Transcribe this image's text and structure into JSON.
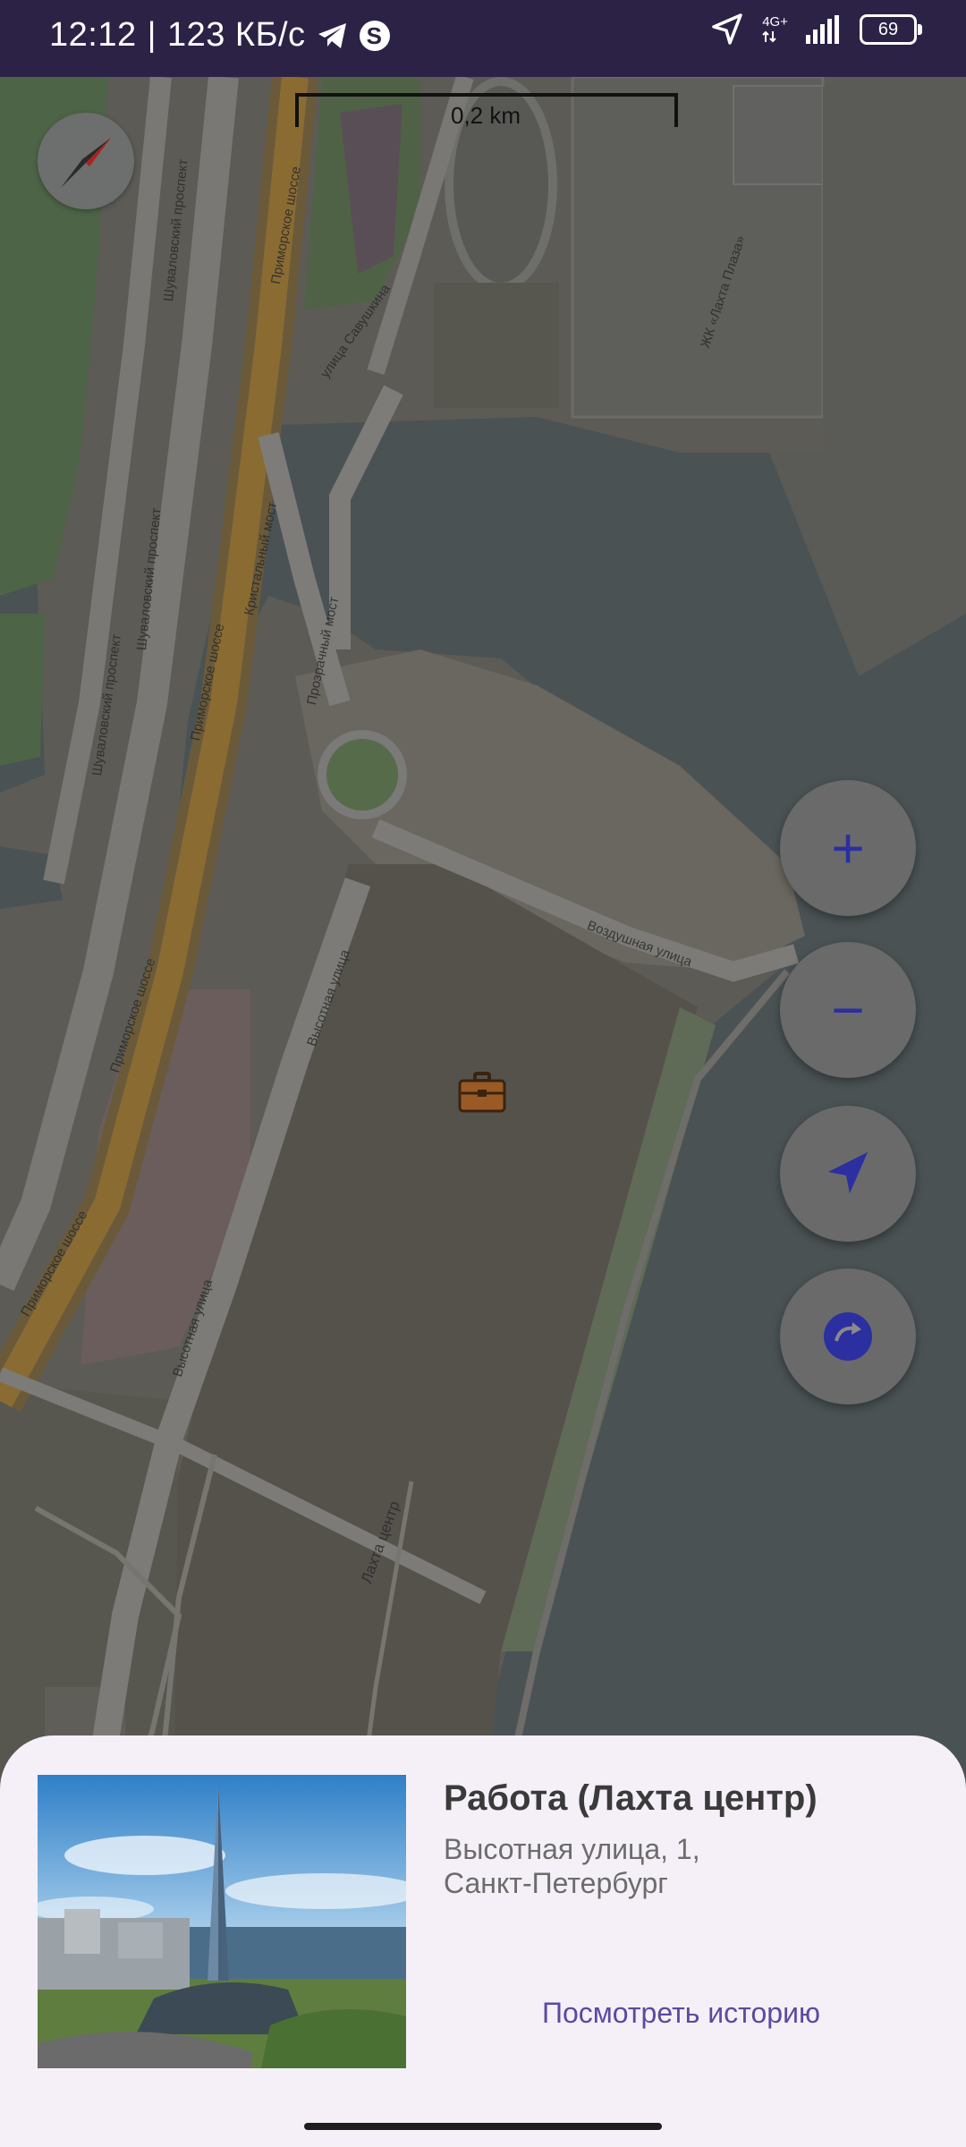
{
  "status_bar": {
    "time": "12:12",
    "separator": "|",
    "speed": "123 КБ/с",
    "network": "4G+",
    "battery": "69",
    "icons": [
      "telegram-icon",
      "skype-icon",
      "location-arrow-icon",
      "signal-icon",
      "battery-icon"
    ]
  },
  "map": {
    "scale_label": "0,2 km",
    "labels": {
      "primorskoe_1": "Приморское шоссе",
      "primorskoe_2": "Приморское шоссе",
      "primorskoe_3": "Приморское шоссе",
      "primorskoe_4": "Приморское шоссе",
      "shuvalovsky_1": "Шуваловский проспект",
      "shuvalovsky_2": "Шуваловский проспект",
      "shuvalovsky_3": "Шуваловский проспект",
      "savushkina": "улица Савушкина",
      "vozdushnaya": "Воздушная улица",
      "vysotnaya_1": "Высотная улица",
      "vysotnaya_2": "Высотная улица",
      "lakhta": "Лахта центр",
      "lakhta_plaza": "ЖК «Лахта Плаза»",
      "bridge_1": "Кристальный мост",
      "bridge_2": "Прозрачный мост"
    }
  },
  "buttons": {
    "zoom_in": "+",
    "zoom_out": "−"
  },
  "place": {
    "title": "Работа (Лахта центр)",
    "address_line1": "Высотная улица, 1,",
    "address_line2": "Санкт-Петербург",
    "history_link": "Посмотреть историю"
  },
  "colors": {
    "status_bar": "#2c2246",
    "fab_icon": "#2b2fa0",
    "sheet_bg": "#f5f0f8",
    "link": "#5a4aa0",
    "water": "#4a5254"
  }
}
